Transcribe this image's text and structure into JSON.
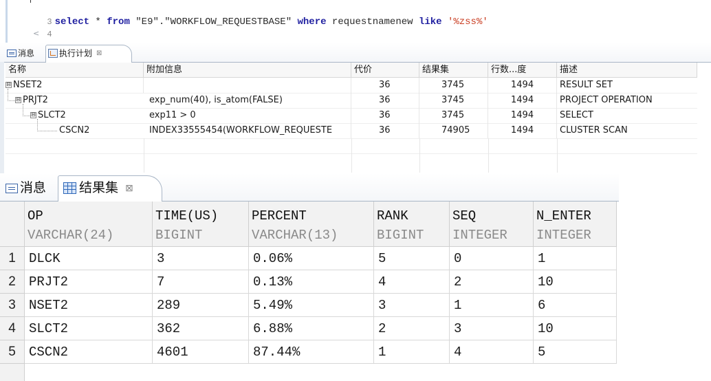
{
  "editor": {
    "lines": [
      {
        "num": "3",
        "tokens": [
          {
            "t": "kw",
            "v": "select"
          },
          {
            "t": "plain",
            "v": " * "
          },
          {
            "t": "kw",
            "v": "from"
          },
          {
            "t": "plain",
            "v": " \"E9\".\"WORKFLOW_REQUESTBASE\" "
          },
          {
            "t": "kw",
            "v": "where"
          },
          {
            "t": "plain",
            "v": " requestnamenew "
          },
          {
            "t": "kw",
            "v": "like"
          },
          {
            "t": "plain",
            "v": " "
          },
          {
            "t": "str",
            "v": "'%zss%'"
          }
        ]
      },
      {
        "num": "4",
        "tokens": []
      }
    ],
    "scroll_arrow": "<"
  },
  "plan_panel": {
    "tabs": [
      {
        "label": "消息",
        "icon": "message-icon",
        "active": false
      },
      {
        "label": "执行计划",
        "icon": "execution-plan-icon",
        "active": true,
        "close": "⊠"
      }
    ],
    "columns": [
      "名称",
      "附加信息",
      "代价",
      "结果集",
      "行数...度",
      "描述"
    ],
    "rows": [
      {
        "name": "NSET2",
        "info": "",
        "cost": "36",
        "resultset": "3745",
        "rows": "1494",
        "desc": "RESULT SET",
        "level": 0,
        "toggle": "⊟"
      },
      {
        "name": "PRJT2",
        "info": "exp_num(40), is_atom(FALSE)",
        "cost": "36",
        "resultset": "3745",
        "rows": "1494",
        "desc": "PROJECT OPERATION",
        "level": 1,
        "toggle": "⊟"
      },
      {
        "name": "SLCT2",
        "info": "exp11 > 0",
        "cost": "36",
        "resultset": "3745",
        "rows": "1494",
        "desc": "SELECT",
        "level": 2,
        "toggle": "⊟"
      },
      {
        "name": "CSCN2",
        "info": "INDEX33555454(WORKFLOW_REQUESTE",
        "cost": "36",
        "resultset": "74905",
        "rows": "1494",
        "desc": "CLUSTER SCAN",
        "level": 3,
        "toggle": ""
      }
    ]
  },
  "result_panel": {
    "tabs": [
      {
        "label": "消息",
        "icon": "message-icon",
        "active": false
      },
      {
        "label": "结果集",
        "icon": "result-grid-icon",
        "active": true,
        "close": "⊠"
      }
    ],
    "columns": [
      {
        "name": "OP",
        "type": "VARCHAR(24)"
      },
      {
        "name": "TIME(US)",
        "type": "BIGINT"
      },
      {
        "name": "PERCENT",
        "type": "VARCHAR(13)"
      },
      {
        "name": "RANK",
        "type": "BIGINT"
      },
      {
        "name": "SEQ",
        "type": "INTEGER"
      },
      {
        "name": "N_ENTER",
        "type": "INTEGER"
      }
    ],
    "rows": [
      {
        "num": "1",
        "cells": [
          "DLCK",
          "3",
          "0.06%",
          "5",
          "0",
          "1"
        ]
      },
      {
        "num": "2",
        "cells": [
          "PRJT2",
          "7",
          "0.13%",
          "4",
          "2",
          "10"
        ]
      },
      {
        "num": "3",
        "cells": [
          "NSET2",
          "289",
          "5.49%",
          "3",
          "1",
          "6"
        ]
      },
      {
        "num": "4",
        "cells": [
          "SLCT2",
          "362",
          "6.88%",
          "2",
          "3",
          "10"
        ]
      },
      {
        "num": "5",
        "cells": [
          "CSCN2",
          "4601",
          "87.44%",
          "1",
          "4",
          "5"
        ]
      }
    ]
  }
}
